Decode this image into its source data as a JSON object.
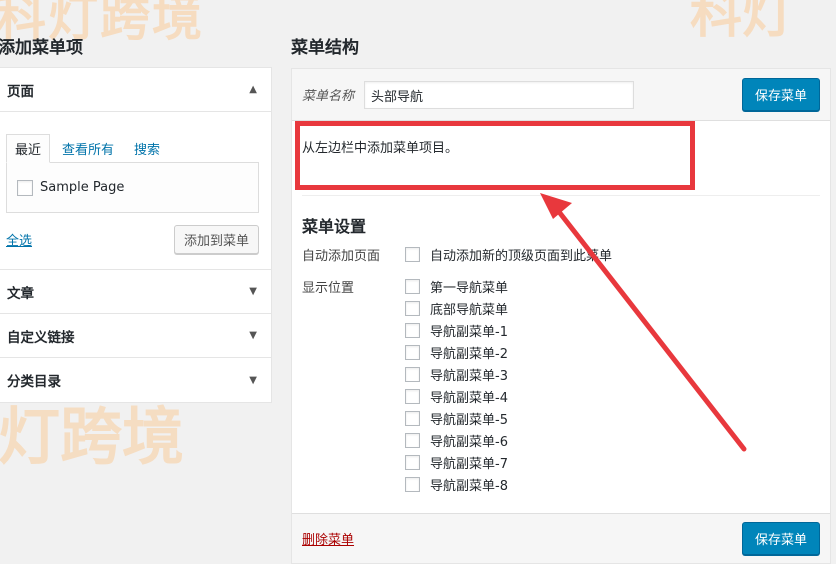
{
  "watermark": {
    "text": "科灯跨境",
    "text_short": "科灯",
    "text_left": "灯跨境",
    "text_right": "科灯"
  },
  "left_panel": {
    "title": "添加菜单项",
    "sections": [
      {
        "label": "页面",
        "expanded": true
      },
      {
        "label": "文章",
        "expanded": false
      },
      {
        "label": "自定义链接",
        "expanded": false
      },
      {
        "label": "分类目录",
        "expanded": false
      }
    ],
    "tabs": [
      "最近",
      "查看所有",
      "搜索"
    ],
    "items": [
      {
        "label": "Sample Page",
        "checked": false
      }
    ],
    "select_all": "全选",
    "add_button": "添加到菜单"
  },
  "right_panel": {
    "title": "菜单结构",
    "menu_name_label": "菜单名称",
    "menu_name_value": "头部导航",
    "save_button": "保存菜单",
    "instructions": "从左边栏中添加菜单项目。",
    "settings_title": "菜单设置",
    "auto_add_label": "自动添加页面",
    "auto_add_option": "自动添加新的顶级页面到此菜单",
    "display_label": "显示位置",
    "locations": [
      "第一导航菜单",
      "底部导航菜单",
      "导航副菜单-1",
      "导航副菜单-2",
      "导航副菜单-3",
      "导航副菜单-4",
      "导航副菜单-5",
      "导航副菜单-6",
      "导航副菜单-7",
      "导航副菜单-8"
    ],
    "delete_link": "删除菜单"
  },
  "colors": {
    "accent": "#0085ba",
    "annotation": "#e8383d",
    "watermark": "#f6dcc0",
    "link": "#0073aa",
    "delete": "#aa0000"
  }
}
